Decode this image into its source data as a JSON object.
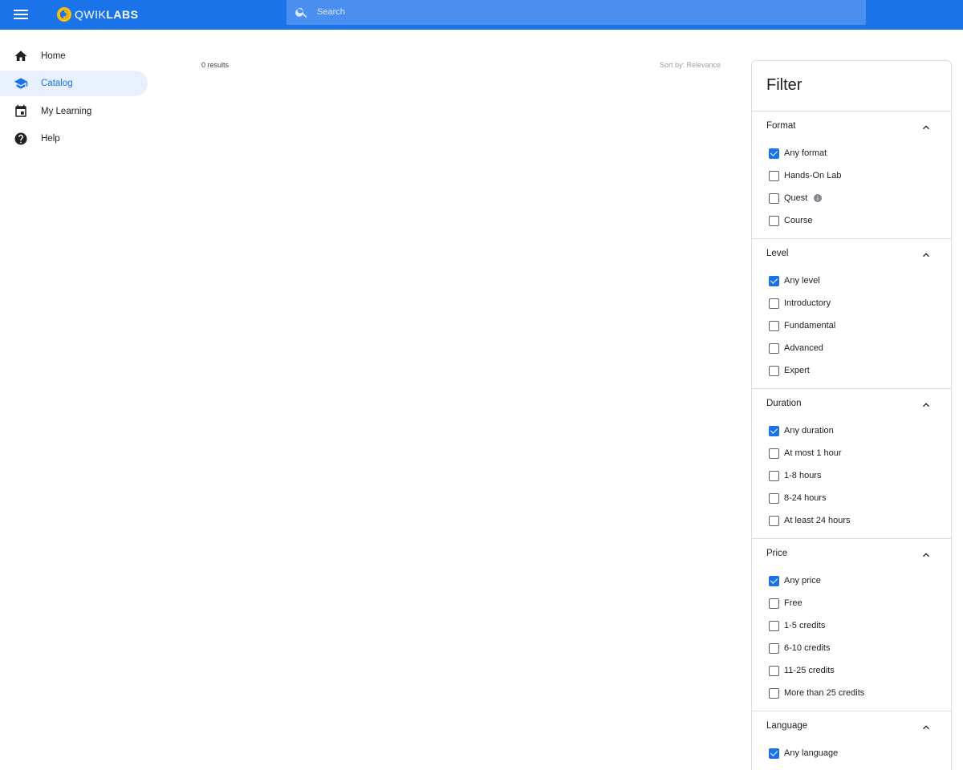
{
  "header": {
    "menu_icon": "menu-icon",
    "brand_prefix": "QWIK",
    "brand_suffix": "LABS",
    "search_placeholder": "Search",
    "accent_color": "#1a73e8"
  },
  "sidebar": {
    "items": [
      {
        "label": "Home",
        "icon": "home-icon",
        "active": false
      },
      {
        "label": "Catalog",
        "icon": "school-icon",
        "active": true
      },
      {
        "label": "My Learning",
        "icon": "calendar-icon",
        "active": false
      },
      {
        "label": "Help",
        "icon": "help-icon",
        "active": false
      }
    ]
  },
  "main": {
    "results_count": "0 results",
    "sort_by": "Sort by: Relevance"
  },
  "filter": {
    "title": "Filter",
    "sections": [
      {
        "title": "Format",
        "options": [
          {
            "label": "Any format",
            "checked": true
          },
          {
            "label": "Hands-On Lab",
            "checked": false
          },
          {
            "label": "Quest",
            "checked": false,
            "info": true
          },
          {
            "label": "Course",
            "checked": false
          }
        ]
      },
      {
        "title": "Level",
        "options": [
          {
            "label": "Any level",
            "checked": true
          },
          {
            "label": "Introductory",
            "checked": false
          },
          {
            "label": "Fundamental",
            "checked": false
          },
          {
            "label": "Advanced",
            "checked": false
          },
          {
            "label": "Expert",
            "checked": false
          }
        ]
      },
      {
        "title": "Duration",
        "options": [
          {
            "label": "Any duration",
            "checked": true
          },
          {
            "label": "At most 1 hour",
            "checked": false
          },
          {
            "label": "1-8 hours",
            "checked": false
          },
          {
            "label": "8-24 hours",
            "checked": false
          },
          {
            "label": "At least 24 hours",
            "checked": false
          }
        ]
      },
      {
        "title": "Price",
        "options": [
          {
            "label": "Any price",
            "checked": true
          },
          {
            "label": "Free",
            "checked": false
          },
          {
            "label": "1-5 credits",
            "checked": false
          },
          {
            "label": "6-10 credits",
            "checked": false
          },
          {
            "label": "11-25 credits",
            "checked": false
          },
          {
            "label": "More than 25 credits",
            "checked": false
          }
        ]
      },
      {
        "title": "Language",
        "options": [
          {
            "label": "Any language",
            "checked": true
          }
        ]
      }
    ]
  }
}
